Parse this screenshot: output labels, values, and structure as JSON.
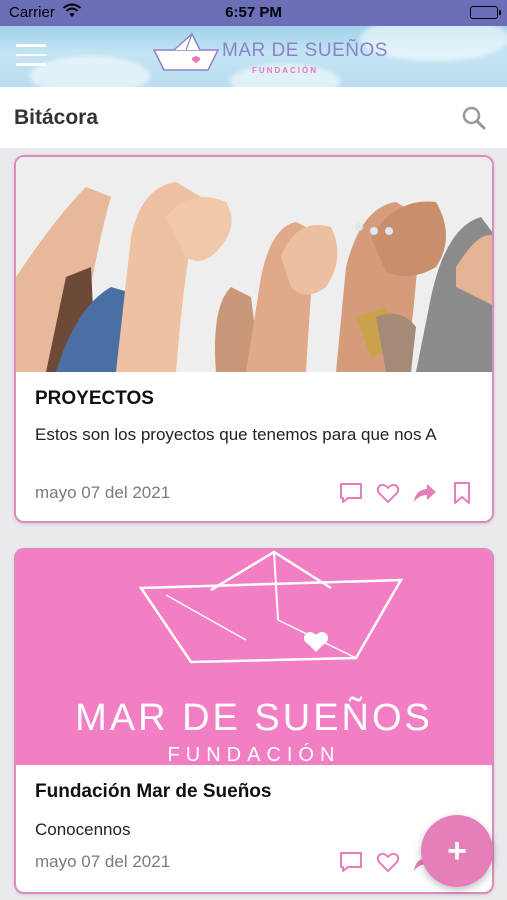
{
  "status_bar": {
    "carrier": "Carrier",
    "time": "6:57 PM"
  },
  "header": {
    "logo_title": "MAR DE SUEÑOS",
    "logo_subtitle": "FUNDACIÓN"
  },
  "page": {
    "title": "Bitácora"
  },
  "posts": [
    {
      "title": "PROYECTOS",
      "excerpt": "Estos son los proyectos que tenemos para que nos A",
      "date": "mayo 07 del 2021",
      "actions": [
        "comment-icon",
        "heart-icon",
        "share-icon",
        "bookmark-icon"
      ]
    },
    {
      "title": "Fundación Mar de Sueños",
      "excerpt": "Conocennos",
      "date": "mayo 07 del 2021",
      "image_text_title": "MAR DE SUEÑOS",
      "image_text_subtitle": "FUNDACIÓN",
      "actions": [
        "comment-icon",
        "heart-icon",
        "share-icon",
        "bookmark-icon"
      ]
    }
  ],
  "fab": {
    "label": "+"
  },
  "colors": {
    "accent": "#e67fb9",
    "card_border": "#e08abb",
    "logo_text": "#8b82c7",
    "status_bar": "#6c6fb8"
  }
}
